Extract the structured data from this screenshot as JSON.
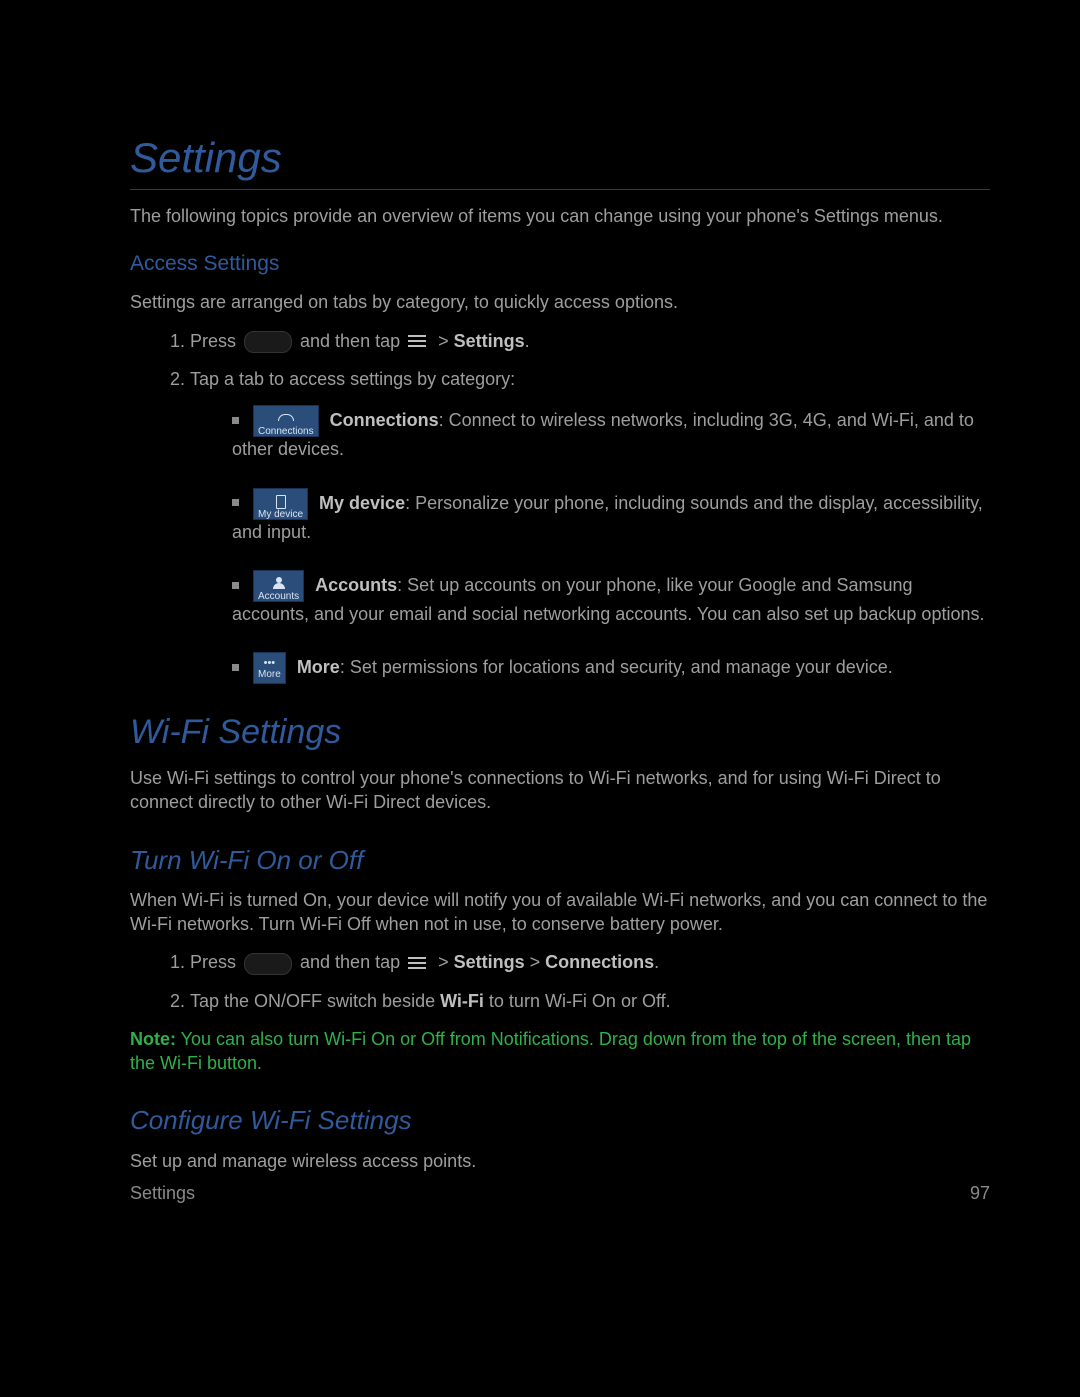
{
  "page_title": "Settings",
  "intro_text": "The following topics provide an overview of items you can change using your phone's Settings menus.",
  "access_settings": {
    "heading": "Access Settings",
    "intro": "Settings are arranged on tabs by category, to quickly access options.",
    "step1_a": "Press ",
    "step1_b": " and then tap ",
    "step1_c": " > ",
    "step1_settings_bold": "Settings",
    "step1_d": ".",
    "step2": "Tap a tab to access settings by category:",
    "tabs": {
      "connections": {
        "label": "Connections",
        "bold": "Connections",
        "desc": ": Connect to wireless networks, including 3G, 4G, and Wi-Fi, and to other devices."
      },
      "mydevice": {
        "label": "My device",
        "bold": "My device",
        "desc": ": Personalize your phone, including sounds and the display, accessibility, and input."
      },
      "accounts": {
        "label": "Accounts",
        "bold": "Accounts",
        "desc": ": Set up accounts on your phone, like your Google and Samsung accounts, and your email and social networking accounts. You can also set up backup options."
      },
      "more": {
        "label": "More",
        "bold": "More",
        "desc": ": Set permissions for locations and security, and manage your device."
      }
    }
  },
  "wifi_settings": {
    "heading": "Wi-Fi Settings",
    "intro": "Use Wi-Fi settings to control your phone's connections to Wi-Fi networks, and for using Wi-Fi Direct to connect directly to other Wi-Fi Direct devices."
  },
  "turn_wifi": {
    "heading": "Turn Wi-Fi On or Off",
    "intro": "When Wi-Fi is turned On, your device will notify you of available Wi-Fi networks, and you can connect to the Wi-Fi networks. Turn Wi-Fi Off when not in use, to conserve battery power.",
    "step1_a": "Press ",
    "step1_b": " and then tap ",
    "step1_c": " > ",
    "step1_settings_bold": "Settings",
    "step1_d": " > ",
    "step1_connections_bold": "Connections",
    "step1_e": ".",
    "step2_a": "Tap the ON/OFF switch beside ",
    "step2_wifi_bold": "Wi-Fi",
    "step2_b": " to turn Wi-Fi On or Off.",
    "note_label": "Note:",
    "note_text": " You can also turn Wi-Fi On or Off from Notifications. Drag down from the top of the screen, then tap the Wi-Fi button."
  },
  "configure_wifi": {
    "heading": "Configure Wi-Fi Settings",
    "intro": "Set up and manage wireless access points."
  },
  "footer": {
    "left": "Settings",
    "right": "97"
  }
}
